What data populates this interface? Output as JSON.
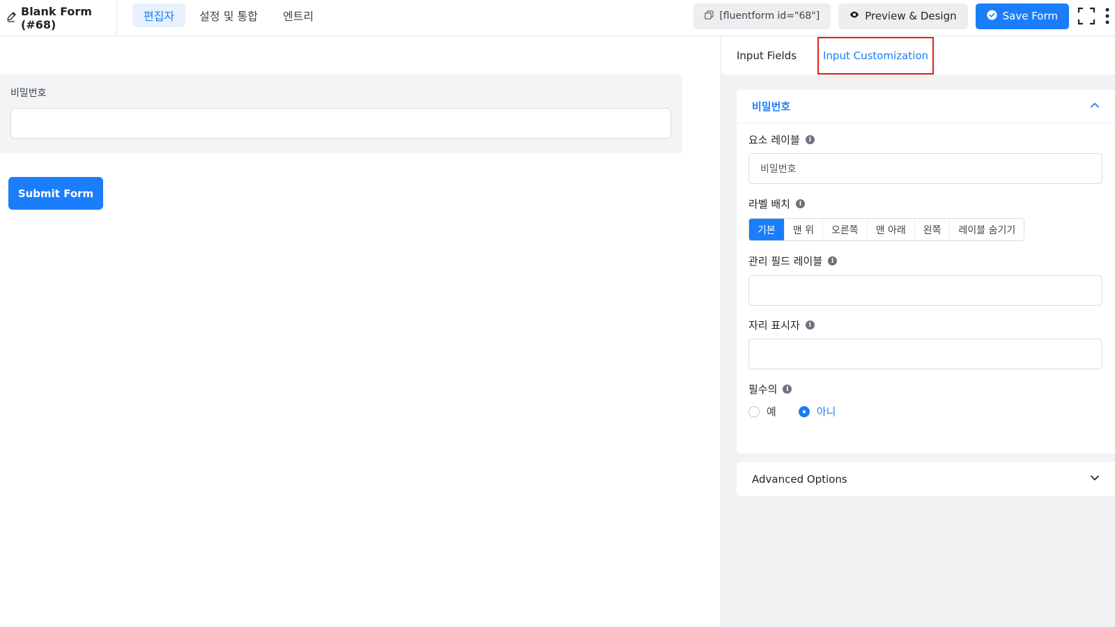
{
  "header": {
    "form_title": "Blank Form (#68)",
    "tabs": [
      {
        "label": "편집자",
        "active": true
      },
      {
        "label": "설정 및 통합",
        "active": false
      },
      {
        "label": "엔트리",
        "active": false
      }
    ],
    "shortcode": "[fluentform id=\"68\"]",
    "preview_label": "Preview & Design",
    "save_label": "Save Form",
    "accent_color": "#1a7efb"
  },
  "editor": {
    "field_label": "비밀번호",
    "submit_label": "Submit Form"
  },
  "panel": {
    "tabs": [
      {
        "label": "Input Fields",
        "active": false
      },
      {
        "label": "Input Customization",
        "active": true
      }
    ],
    "section_title": "비밀번호",
    "element_label": {
      "label": "요소 레이블",
      "value": "비밀번호"
    },
    "label_placement": {
      "label": "라벨 배치",
      "options": [
        "기본",
        "맨 위",
        "오른쪽",
        "맨 아래",
        "왼쪽",
        "레이블 숨기기"
      ],
      "selected": "기본"
    },
    "admin_label": {
      "label": "관리 필드 레이블",
      "value": ""
    },
    "placeholder": {
      "label": "자리 표시자",
      "value": ""
    },
    "required": {
      "label": "필수의",
      "options": [
        "예",
        "아니"
      ],
      "selected": "아니"
    },
    "advanced_label": "Advanced Options"
  }
}
